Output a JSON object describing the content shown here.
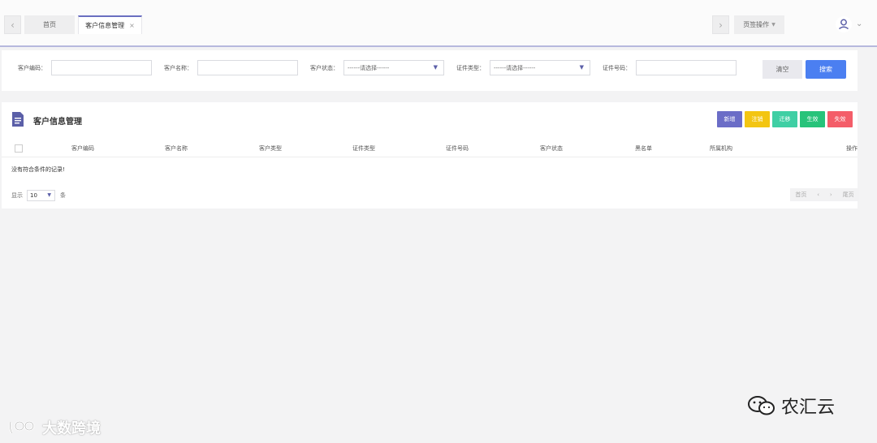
{
  "tabs": {
    "home": "首页",
    "active": "客户信息管理",
    "close_glyph": "×",
    "page_ops": "页签操作"
  },
  "search": {
    "fields": [
      {
        "label": "客户编码："
      },
      {
        "label": "客户名称："
      },
      {
        "label": "客户状态：",
        "selected": "------请选择------"
      },
      {
        "label": "证件类型：",
        "selected": "------请选择------"
      },
      {
        "label": "证件号码："
      }
    ],
    "clear_label": "清空",
    "search_label": "搜索"
  },
  "panel": {
    "title": "客户信息管理",
    "actions": [
      {
        "label": "新增",
        "color": "#6b6dc7"
      },
      {
        "label": "注销",
        "color": "#f3c512"
      },
      {
        "label": "迁移",
        "color": "#3fcfa4"
      },
      {
        "label": "生效",
        "color": "#27c37a"
      },
      {
        "label": "失效",
        "color": "#f45d69"
      }
    ],
    "columns": [
      "客户编码",
      "客户名称",
      "客户类型",
      "证件类型",
      "证件号码",
      "客户状态",
      "黑名单",
      "所属机构",
      "操作"
    ],
    "empty_message": "没有符合条件的记录!",
    "pager": {
      "show_label": "显示",
      "page_size": "10",
      "unit_label": "条",
      "first": "首页",
      "prev": "‹",
      "next": "›",
      "last": "尾页"
    }
  },
  "watermarks": {
    "left": "大数跨境",
    "right": "农汇云"
  },
  "colors": {
    "accent": "#6a6fc0",
    "primary": "#4b7ff1"
  }
}
